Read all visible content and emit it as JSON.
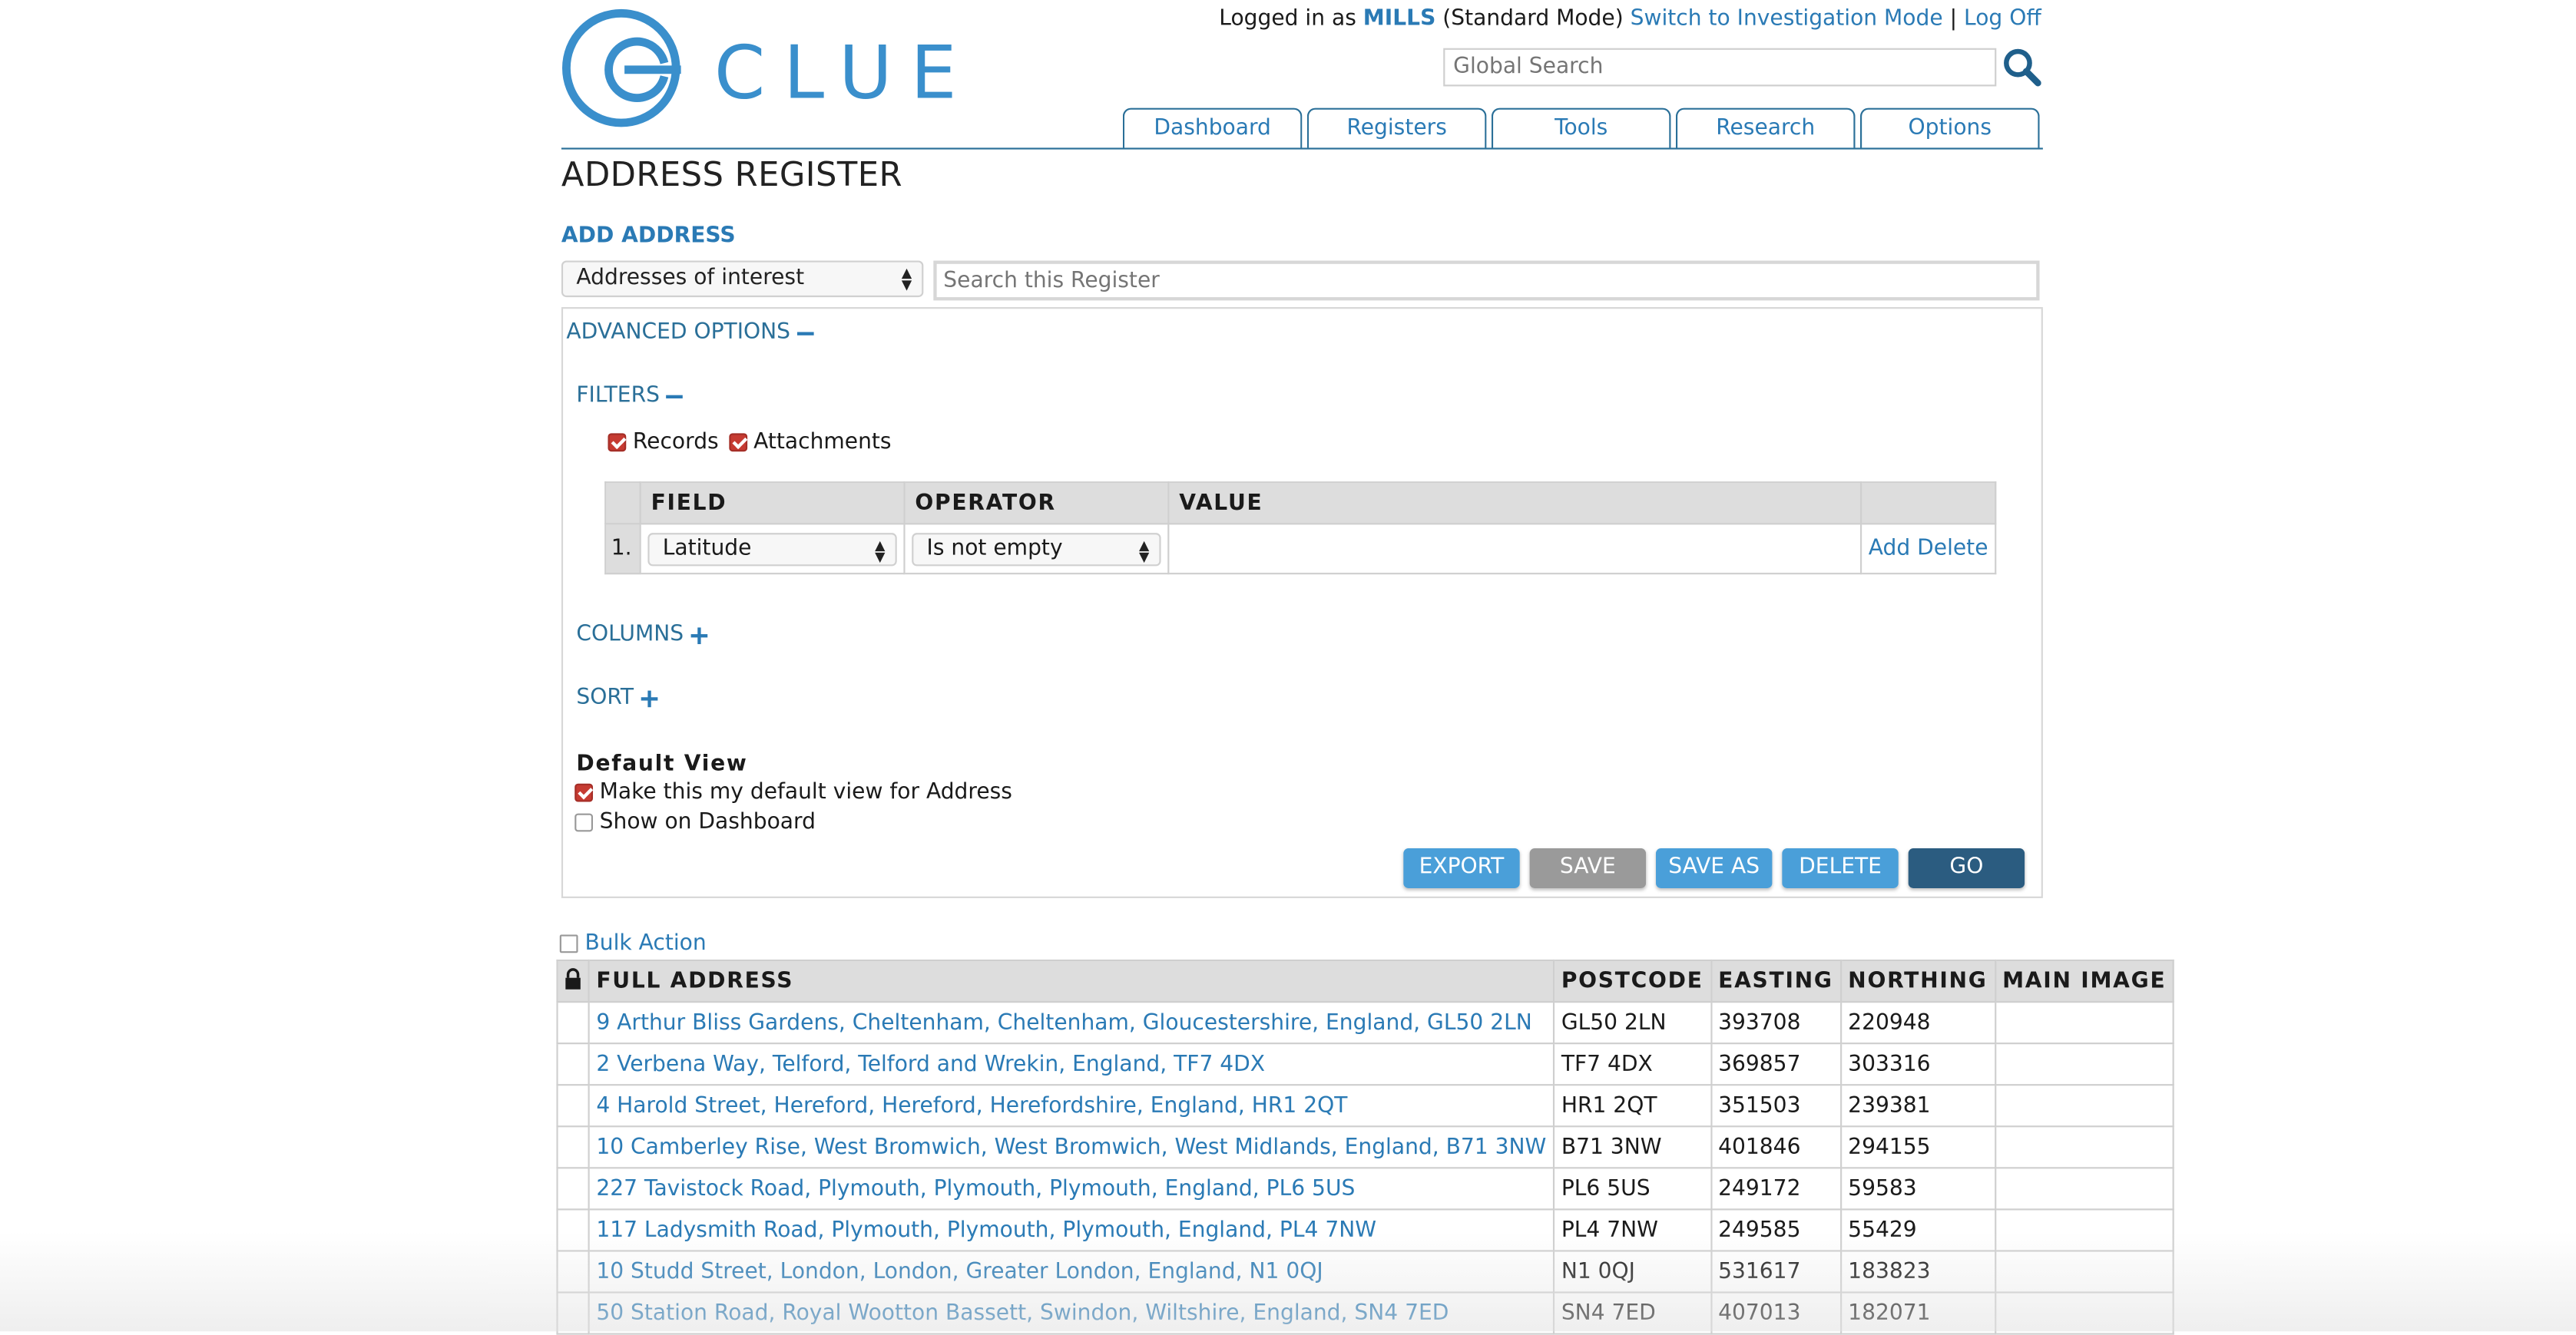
{
  "header": {
    "logo_text": "CLUE",
    "logged_in_prefix": "Logged in as",
    "username": "MILLS",
    "mode": "(Standard Mode)",
    "switch_mode_link": "Switch to Investigation Mode",
    "separator": "|",
    "log_off": "Log Off",
    "global_search_placeholder": "Global Search"
  },
  "nav": {
    "tabs": [
      "Dashboard",
      "Registers",
      "Tools",
      "Research",
      "Options"
    ]
  },
  "page": {
    "title": "ADDRESS REGISTER",
    "add_link": "ADD ADDRESS",
    "view_select": "Addresses of interest",
    "register_search_placeholder": "Search this Register"
  },
  "advanced": {
    "title": "ADVANCED OPTIONS",
    "filters_label": "FILTERS",
    "records_label": "Records",
    "records_checked": true,
    "attachments_label": "Attachments",
    "attachments_checked": true,
    "filter_table": {
      "headers": [
        "FIELD",
        "OPERATOR",
        "VALUE"
      ],
      "rows": [
        {
          "num": "1.",
          "field": "Latitude",
          "operator": "Is not empty",
          "value": "",
          "add": "Add",
          "delete": "Delete"
        }
      ]
    },
    "columns_label": "COLUMNS",
    "sort_label": "SORT",
    "default_view_title": "Default View",
    "make_default_label": "Make this my default view for Address",
    "make_default_checked": true,
    "show_dashboard_label": "Show on Dashboard",
    "show_dashboard_checked": false,
    "buttons": {
      "export": "EXPORT",
      "save": "SAVE",
      "save_as": "SAVE AS",
      "delete": "DELETE",
      "go": "GO"
    }
  },
  "results": {
    "bulk_action": "Bulk Action",
    "headers": {
      "address": "FULL ADDRESS",
      "postcode": "POSTCODE",
      "easting": "EASTING",
      "northing": "NORTHING",
      "image": "MAIN IMAGE"
    },
    "rows": [
      {
        "address": "9 Arthur Bliss Gardens, Cheltenham, Cheltenham, Gloucestershire, England, GL50 2LN",
        "postcode": "GL50 2LN",
        "easting": "393708",
        "northing": "220948"
      },
      {
        "address": "2 Verbena Way, Telford, Telford and Wrekin, England, TF7 4DX",
        "postcode": "TF7 4DX",
        "easting": "369857",
        "northing": "303316"
      },
      {
        "address": "4 Harold Street, Hereford, Hereford, Herefordshire, England, HR1 2QT",
        "postcode": "HR1 2QT",
        "easting": "351503",
        "northing": "239381"
      },
      {
        "address": "10 Camberley Rise, West Bromwich, West Bromwich, West Midlands, England, B71 3NW",
        "postcode": "B71 3NW",
        "easting": "401846",
        "northing": "294155"
      },
      {
        "address": "227 Tavistock Road, Plymouth, Plymouth, Plymouth, England, PL6 5US",
        "postcode": "PL6 5US",
        "easting": "249172",
        "northing": "59583"
      },
      {
        "address": "117 Ladysmith Road, Plymouth, Plymouth, Plymouth, England, PL4 7NW",
        "postcode": "PL4 7NW",
        "easting": "249585",
        "northing": "55429"
      },
      {
        "address": "10 Studd Street, London, London, Greater London, England, N1 0QJ",
        "postcode": "N1 0QJ",
        "easting": "531617",
        "northing": "183823"
      },
      {
        "address": "50 Station Road, Royal Wootton Bassett, Swindon, Wiltshire, England, SN4 7ED",
        "postcode": "SN4 7ED",
        "easting": "407013",
        "northing": "182071"
      }
    ]
  },
  "colors": {
    "brand": "#2a7ab5",
    "checkbox_red": "#c63b32",
    "button_blue": "#4a9fd9",
    "button_gray": "#9a9a9a",
    "button_dark": "#2b5c80"
  }
}
